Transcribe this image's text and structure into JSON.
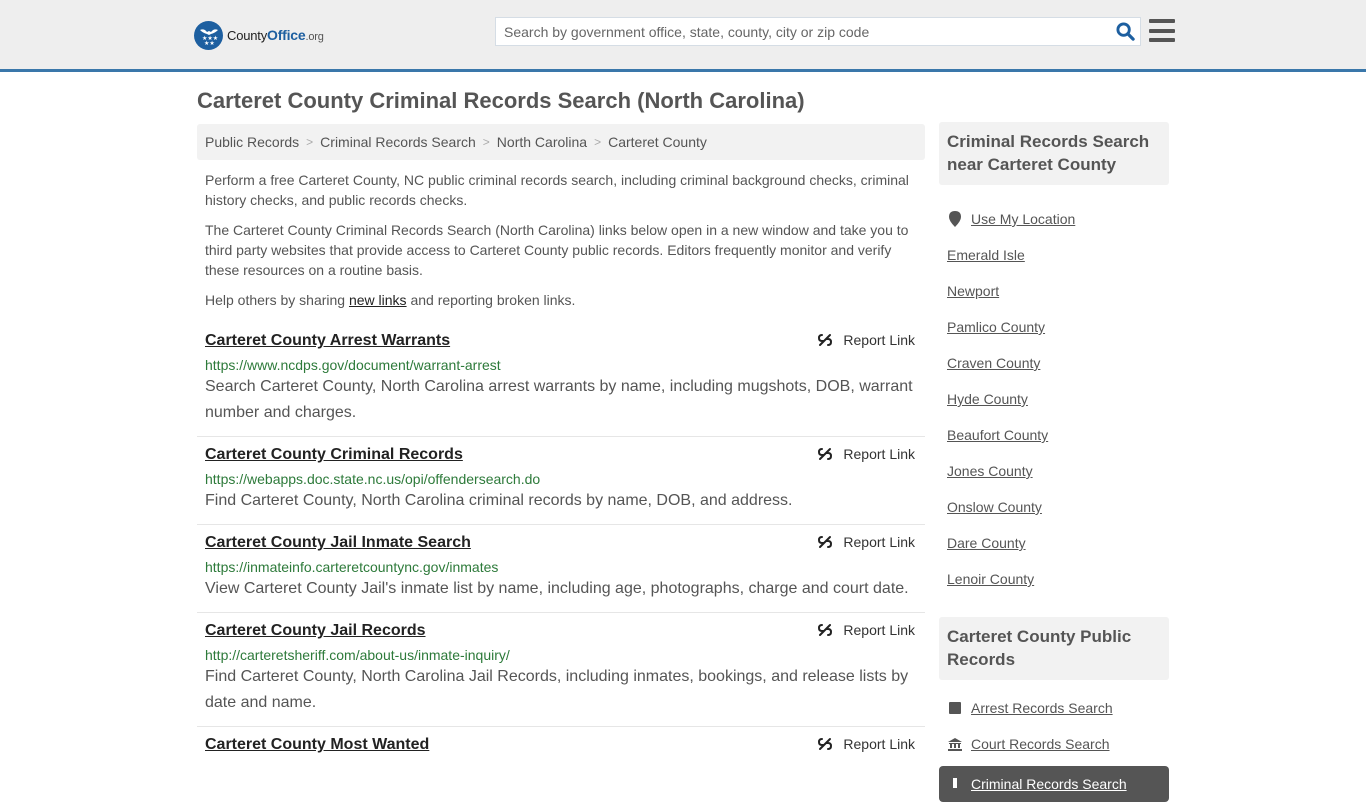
{
  "header": {
    "logo": {
      "name": "County",
      "office": "Office",
      "tld": ".org"
    },
    "search": {
      "placeholder": "Search by government office, state, county, city or zip code",
      "value": ""
    },
    "colors": {
      "brand": "#1d5fa0",
      "header_bg": "#eeeeee",
      "header_border": "#3a77aa"
    }
  },
  "page": {
    "title": "Carteret County Criminal Records Search (North Carolina)",
    "breadcrumb": [
      {
        "label": "Public Records"
      },
      {
        "label": "Criminal Records Search"
      },
      {
        "label": "North Carolina"
      },
      {
        "label": "Carteret County"
      }
    ],
    "intro": {
      "p1": "Perform a free Carteret County, NC public criminal records search, including criminal background checks, criminal history checks, and public records checks.",
      "p2": "The Carteret County Criminal Records Search (North Carolina) links below open in a new window and take you to third party websites that provide access to Carteret County public records. Editors frequently monitor and verify these resources on a routine basis.",
      "p3_before": "Help others by sharing ",
      "p3_link": "new links",
      "p3_after": " and reporting broken links."
    }
  },
  "results": [
    {
      "title": "Carteret County Arrest Warrants",
      "url": "https://www.ncdps.gov/document/warrant-arrest",
      "description": "Search Carteret County, North Carolina arrest warrants by name, including mugshots, DOB, warrant number and charges.",
      "report_label": "Report Link"
    },
    {
      "title": "Carteret County Criminal Records",
      "url": "https://webapps.doc.state.nc.us/opi/offendersearch.do",
      "description": "Find Carteret County, North Carolina criminal records by name, DOB, and address.",
      "report_label": "Report Link"
    },
    {
      "title": "Carteret County Jail Inmate Search",
      "url": "https://inmateinfo.carteretcountync.gov/inmates",
      "description": "View Carteret County Jail's inmate list by name, including age, photographs, charge and court date.",
      "report_label": "Report Link"
    },
    {
      "title": "Carteret County Jail Records",
      "url": "http://carteretsheriff.com/about-us/inmate-inquiry/",
      "description": "Find Carteret County, North Carolina Jail Records, including inmates, bookings, and release lists by date and name.",
      "report_label": "Report Link"
    },
    {
      "title": "Carteret County Most Wanted",
      "url": "",
      "description": "",
      "report_label": "Report Link"
    }
  ],
  "sidebar": {
    "near": {
      "heading": "Criminal Records Search near Carteret County",
      "use_location": "Use My Location",
      "items": [
        "Emerald Isle",
        "Newport",
        "Pamlico County",
        "Craven County",
        "Hyde County",
        "Beaufort County",
        "Jones County",
        "Onslow County",
        "Dare County",
        "Lenoir County"
      ]
    },
    "public_records": {
      "heading": "Carteret County Public Records",
      "items": [
        {
          "label": "Arrest Records Search",
          "icon": "square-icon"
        },
        {
          "label": "Court Records Search",
          "icon": "courthouse-icon"
        }
      ],
      "active": {
        "label": "Criminal Records Search",
        "icon": "exclamation-icon"
      }
    }
  }
}
